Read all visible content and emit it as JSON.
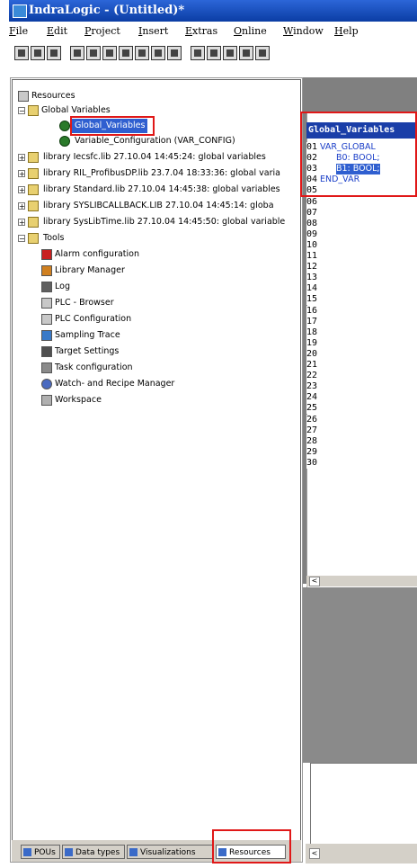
{
  "window": {
    "title": "IndraLogic - (Untitled)*"
  },
  "menu": [
    "File",
    "Edit",
    "Project",
    "Insert",
    "Extras",
    "Online",
    "Window",
    "Help"
  ],
  "tree": {
    "root": "Resources",
    "global_variables_folder": "Global Variables",
    "items": [
      "Global_Variables",
      "Variable_Configuration (VAR_CONFIG)",
      "library Iecsfc.lib 27.10.04 14:45:24: global variables",
      "library RIL_ProfibusDP.lib 23.7.04 18:33:36: global varia",
      "library Standard.lib 27.10.04 14:45:38: global variables",
      "library SYSLIBCALLBACK.LIB 27.10.04 14:45:14: globa",
      "library SysLibTime.lib 27.10.04 14:45:50: global variable"
    ],
    "tools_folder": "Tools",
    "tools": [
      "Alarm configuration",
      "Library Manager",
      "Log",
      "PLC - Browser",
      "PLC Configuration",
      "Sampling Trace",
      "Target Settings",
      "Task configuration",
      "Watch- and Recipe Manager",
      "Workspace"
    ]
  },
  "editor": {
    "title": "Global_Variables",
    "lines": [
      "01",
      "02",
      "03",
      "04",
      "05",
      "06",
      "07",
      "08",
      "09",
      "10",
      "11",
      "12",
      "13",
      "14",
      "15",
      "16",
      "17",
      "18",
      "19",
      "20",
      "21",
      "22",
      "23",
      "24",
      "25",
      "26",
      "27",
      "28",
      "29",
      "30"
    ],
    "code": [
      "VAR_GLOBAL",
      "B0: BOOL;",
      "B1: BOOL;",
      "END_VAR"
    ]
  },
  "tabs": [
    "POUs",
    "Data types",
    "Visualizations",
    "Resources"
  ],
  "colors": {
    "highlight_red": "#e01818",
    "code_blue": "#1a3ec8",
    "title_blue": "#1a3ea8",
    "selection": "#2f5fd0"
  }
}
